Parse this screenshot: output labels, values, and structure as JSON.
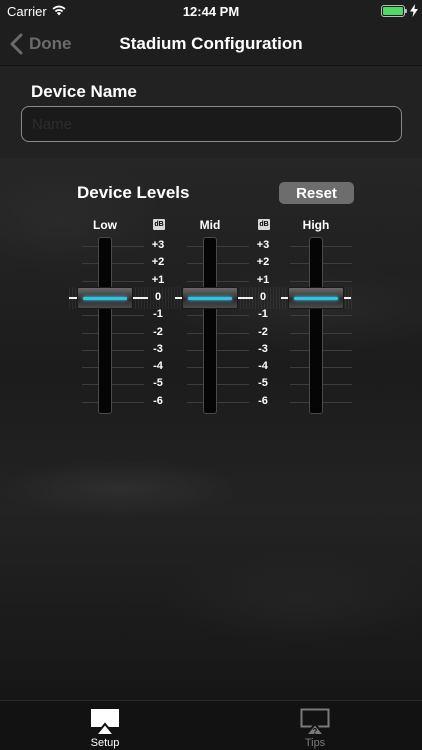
{
  "status_bar": {
    "carrier": "Carrier",
    "time": "12:44 PM"
  },
  "nav": {
    "back_label": "Done",
    "title": "Stadium Configuration"
  },
  "device_name": {
    "label": "Device Name",
    "placeholder": "Name",
    "value": ""
  },
  "levels": {
    "title": "Device Levels",
    "reset_label": "Reset",
    "db_icon_label": "dB",
    "scale": [
      "+3",
      "+2",
      "+1",
      "0",
      "-1",
      "-2",
      "-3",
      "-4",
      "-5",
      "-6"
    ],
    "sliders": [
      {
        "label": "Low",
        "value_db": 0
      },
      {
        "label": "Mid",
        "value_db": 0
      },
      {
        "label": "High",
        "value_db": 0
      }
    ]
  },
  "tabs": [
    {
      "label": "Setup",
      "icon": "airplay-icon",
      "active": true
    },
    {
      "label": "Tips",
      "icon": "airplay-question-icon",
      "active": false
    }
  ],
  "colors": {
    "accent": "#2ec4e6",
    "reset_button": "#6d6d6d",
    "battery": "#4cd964"
  }
}
